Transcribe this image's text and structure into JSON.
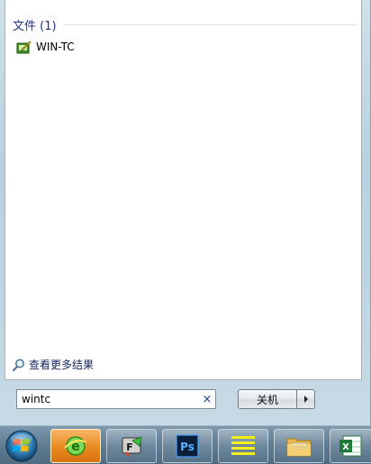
{
  "results": {
    "group_title": "文件 (1)",
    "items": [
      {
        "label": "WIN-TC",
        "icon": "win-tc-app-icon"
      }
    ],
    "more_results_label": "查看更多结果"
  },
  "search": {
    "value": "wintc",
    "clear_label": "×"
  },
  "shutdown": {
    "label": "关机"
  },
  "taskbar": {
    "items": [
      {
        "name": "ie-browser",
        "icon": "ie-icon"
      },
      {
        "name": "foxmail",
        "icon": "foxmail-icon"
      },
      {
        "name": "photoshop",
        "icon": "ps-icon",
        "text": "Ps"
      },
      {
        "name": "notepad",
        "icon": "notepad-icon"
      },
      {
        "name": "explorer",
        "icon": "folder-icon"
      },
      {
        "name": "excel",
        "icon": "excel-icon"
      }
    ]
  }
}
